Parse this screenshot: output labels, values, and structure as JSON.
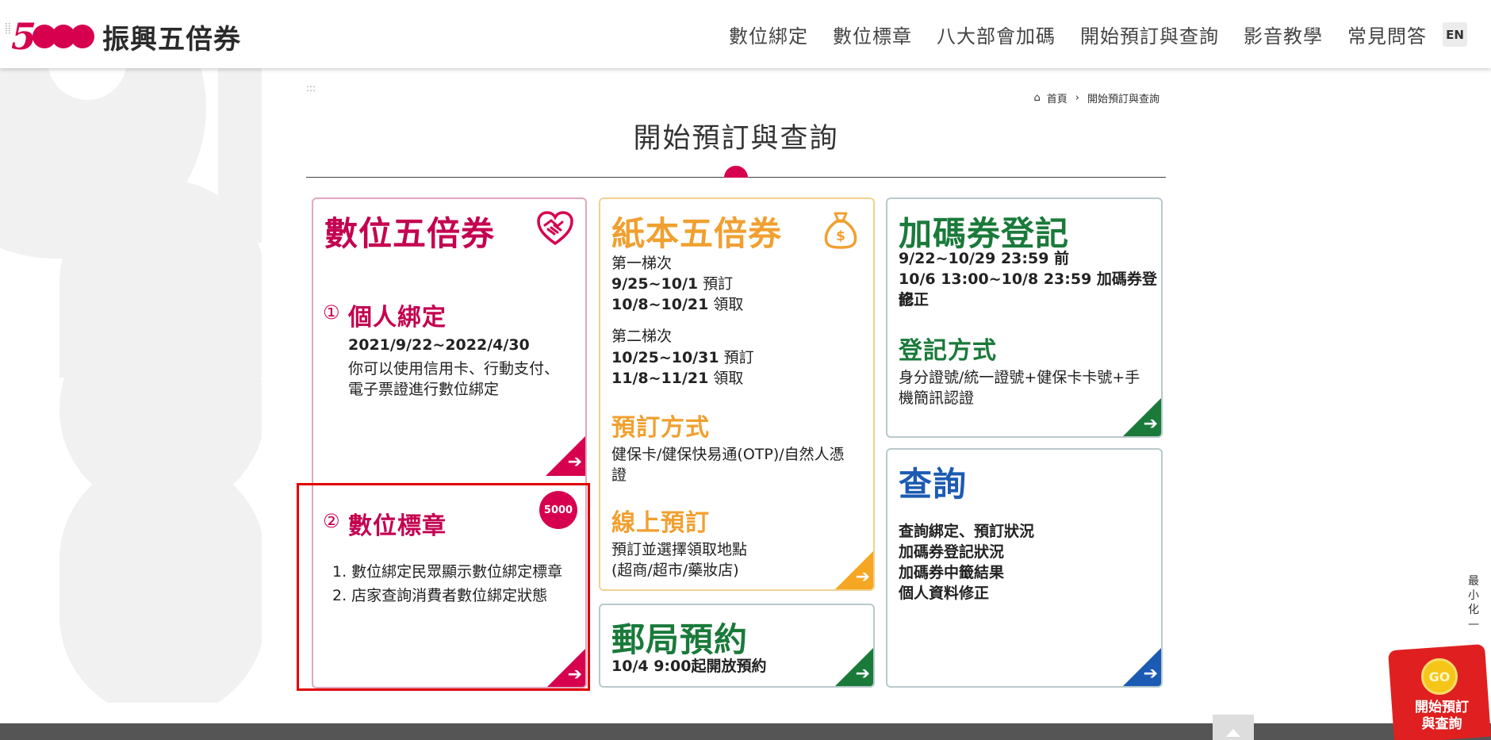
{
  "header": {
    "logo_number": "5",
    "logo_text": "振興五倍券",
    "nav": [
      "數位綁定",
      "數位標章",
      "八大部會加碼",
      "開始預訂與查詢",
      "影音教學",
      "常見問答"
    ],
    "lang": "EN"
  },
  "breadcrumb": {
    "home": "首頁",
    "current": "開始預訂與查詢"
  },
  "page_title": "開始預訂與查詢",
  "digital": {
    "title": "數位五倍券",
    "s1_num": "①",
    "s1_title": "個人綁定",
    "s1_date": "2021/9/22~2022/4/30",
    "s1_desc1": "你可以使用信用卡、行動支付、",
    "s1_desc2": "電子票證進行數位綁定",
    "s2_num": "②",
    "s2_title": "數位標章",
    "s2_item1": "1. 數位綁定民眾顯示數位綁定標章",
    "s2_item2": "2. 店家查詢消費者數位綁定狀態",
    "badge": "5000"
  },
  "paper": {
    "title": "紙本五倍券",
    "r1_label": "第一梯次",
    "r1_a_date": "9/25~10/1",
    "r1_a_act": "預訂",
    "r1_b_date": "10/8~10/21",
    "r1_b_act": "領取",
    "r2_label": "第二梯次",
    "r2_a_date": "10/25~10/31",
    "r2_a_act": "預訂",
    "r2_b_date": "11/8~11/21",
    "r2_b_act": "領取",
    "method_title": "預訂方式",
    "method_desc1": "健保卡/健保快易通(OTP)/自然人憑",
    "method_desc2": "證",
    "online_title": "線上預訂",
    "online_desc1": "預訂並選擇領取地點",
    "online_desc2": "(超商/超市/藥妝店)"
  },
  "post": {
    "title": "郵局預約",
    "desc_date": "10/4 9:00起",
    "desc_text": "開放預約"
  },
  "bonus": {
    "title": "加碼券登記",
    "line1": "9/22~10/29 23:59 前",
    "line2": "10/6 13:00~10/8 23:59 加碼券登記",
    "line3": "修正",
    "method_title": "登記方式",
    "method_desc1": "身分證號/統一證號+健保卡卡號+手",
    "method_desc2": "機簡訊認證"
  },
  "query": {
    "title": "查詢",
    "items": [
      "查詢綁定、預訂狀況",
      "加碼券登記狀況",
      "加碼券中籤結果",
      "個人資料修正"
    ]
  },
  "side": {
    "minimize": "最小化",
    "minimize_dash": "—",
    "float_go": "GO",
    "float_label1": "開始預訂",
    "float_label2": "與查詢"
  },
  "colors": {
    "pink": "#d6004f",
    "orange": "#f5a623",
    "green": "#1a7a3a",
    "blue": "#1c5bb3",
    "highlight": "#e00000"
  },
  "icons": {
    "arrow": "arrow-right-icon",
    "heart": "handshake-heart-icon",
    "bag": "money-bag-icon",
    "home": "home-icon"
  }
}
